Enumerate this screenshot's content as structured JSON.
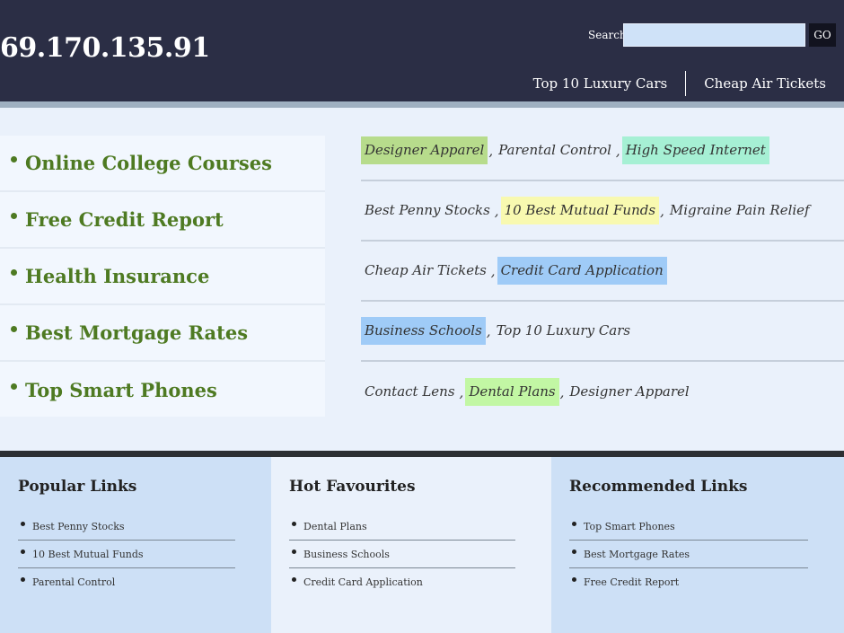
{
  "header": {
    "site_title": "69.170.135.91",
    "search_label": "Search",
    "search_value": "",
    "go_label": "GO",
    "nav": [
      "Top 10 Luxury Cars",
      "Cheap Air Tickets"
    ]
  },
  "left_links": [
    "Online College Courses",
    "Free Credit Report",
    "Health Insurance",
    "Best Mortgage Rates",
    "Top Smart Phones"
  ],
  "tag_rows": [
    [
      {
        "label": "Designer Apparel",
        "highlight": "#b7dc8c"
      },
      {
        "label": "Parental Control",
        "highlight": ""
      },
      {
        "label": "High Speed Internet",
        "highlight": "#a6f0d4"
      }
    ],
    [
      {
        "label": "Best Penny Stocks",
        "highlight": ""
      },
      {
        "label": "10 Best Mutual Funds",
        "highlight": "#f8f9b0"
      },
      {
        "label": "Migraine Pain Relief",
        "highlight": ""
      }
    ],
    [
      {
        "label": "Cheap Air Tickets",
        "highlight": ""
      },
      {
        "label": "Credit Card Application",
        "highlight": "#9fcbf7"
      }
    ],
    [
      {
        "label": "Business Schools",
        "highlight": "#9fcbf7"
      },
      {
        "label": "Top 10 Luxury Cars",
        "highlight": ""
      }
    ],
    [
      {
        "label": "Contact Lens",
        "highlight": ""
      },
      {
        "label": "Dental Plans",
        "highlight": "#c2f7a4"
      },
      {
        "label": "Designer Apparel",
        "highlight": ""
      }
    ]
  ],
  "footer": [
    {
      "title": "Popular Links",
      "links": [
        "Best Penny Stocks",
        "10 Best Mutual Funds",
        "Parental Control"
      ]
    },
    {
      "title": "Hot Favourites",
      "links": [
        "Dental Plans",
        "Business Schools",
        "Credit Card Application"
      ]
    },
    {
      "title": "Recommended Links",
      "links": [
        "Top Smart Phones",
        "Best Mortgage Rates",
        "Free Credit Report"
      ]
    }
  ],
  "colors": {
    "header_bg": "#2b2e45",
    "link_green": "#4e7a22",
    "footer_blue": "#cde0f6"
  }
}
